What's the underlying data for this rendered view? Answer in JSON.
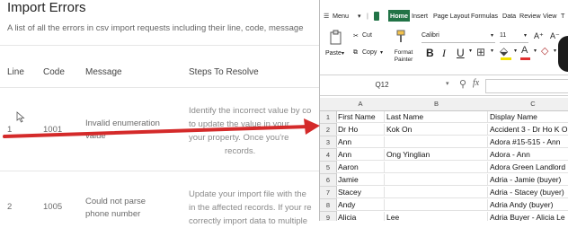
{
  "doc": {
    "title": "Import Errors",
    "subtitle": "A list of all the errors in csv import requests including their line, code, message",
    "headers": [
      "Line",
      "Code",
      "Message",
      "Steps To Resolve"
    ],
    "rows": [
      {
        "line": "1",
        "code": "1001",
        "message": [
          "Invalid enumeration",
          "value"
        ],
        "steps": [
          "Identify the incorrect value by co",
          "to update the value in your",
          "your property. Once you're",
          "records."
        ]
      },
      {
        "line": "2",
        "code": "1005",
        "message": [
          "Could not parse",
          "phone number"
        ],
        "steps": [
          "Update your import file with the",
          "in the affected records. If your re",
          "correctly import data to multiple"
        ]
      }
    ]
  },
  "excel": {
    "menu": {
      "menu": "Menu",
      "home": "Home",
      "insert": "Insert",
      "page_layout": "Page Layout",
      "formulas": "Formulas",
      "data": "Data",
      "review": "Review",
      "view": "View",
      "t": "T"
    },
    "ribbon": {
      "cut": "Cut",
      "paste": "Paste",
      "copy": "Copy",
      "format_painter": "Format Painter",
      "font_name": "Calibri",
      "font_size": "11",
      "bold": "B",
      "italic": "I",
      "underline": "U"
    },
    "name_box": "Q12",
    "fx": "fx",
    "columns": [
      "A",
      "B",
      "C"
    ],
    "rows": [
      {
        "n": "1",
        "a": "First Name",
        "b": "Last Name",
        "c": "Display Name"
      },
      {
        "n": "2",
        "a": "Dr Ho",
        "b": "Kok On",
        "c": "Accident 3 - Dr Ho K O"
      },
      {
        "n": "3",
        "a": "Ann",
        "b": "",
        "c": "Adora #15-515 - Ann"
      },
      {
        "n": "4",
        "a": "Ann",
        "b": "Ong Yinglian",
        "c": "Adora - Ann"
      },
      {
        "n": "5",
        "a": "Aaron",
        "b": "",
        "c": "Adora Green Landlord"
      },
      {
        "n": "6",
        "a": "Jamie",
        "b": "",
        "c": "Adria - Jamie (buyer)"
      },
      {
        "n": "7",
        "a": "Stacey",
        "b": "",
        "c": "Adria - Stacey (buyer)"
      },
      {
        "n": "8",
        "a": "Andy",
        "b": "",
        "c": "Adria Andy (buyer)"
      },
      {
        "n": "9",
        "a": "Alicia",
        "b": "Lee",
        "c": "Adria Buyer - Alicia Le"
      }
    ]
  },
  "colors": {
    "accent": "#217346",
    "arrow": "#d42a2a"
  }
}
